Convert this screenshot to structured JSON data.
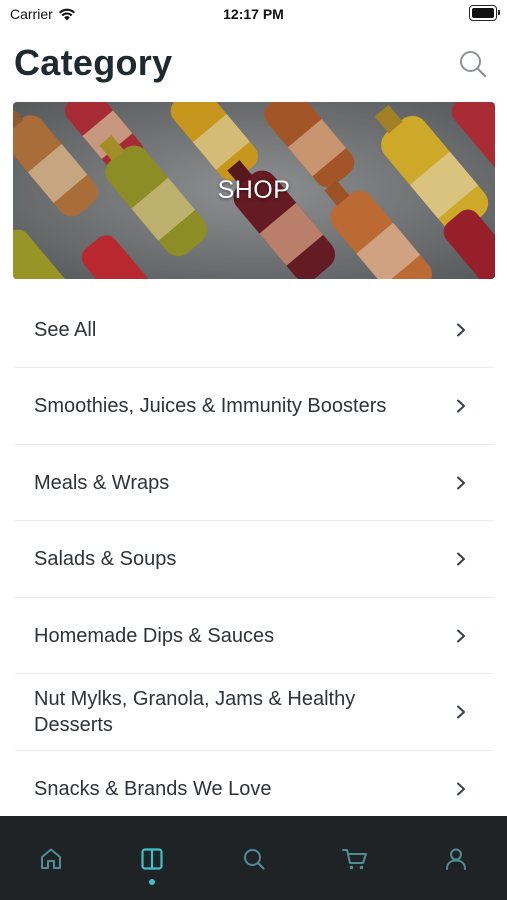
{
  "status_bar": {
    "carrier": "Carrier",
    "time": "12:17 PM"
  },
  "header": {
    "title": "Category"
  },
  "banner": {
    "label": "SHOP"
  },
  "categories": [
    {
      "label": "See All"
    },
    {
      "label": "Smoothies, Juices & Immunity Boosters"
    },
    {
      "label": "Meals & Wraps"
    },
    {
      "label": "Salads & Soups"
    },
    {
      "label": "Homemade Dips & Sauces"
    },
    {
      "label": "Nut Mylks, Granola, Jams & Healthy Desserts"
    },
    {
      "label": "Snacks & Brands We Love"
    }
  ],
  "tab_bar": {
    "tabs": [
      {
        "icon": "home-icon",
        "active": false
      },
      {
        "icon": "catalog-icon",
        "active": true
      },
      {
        "icon": "search-icon",
        "active": false
      },
      {
        "icon": "cart-icon",
        "active": false
      },
      {
        "icon": "profile-icon",
        "active": false
      }
    ]
  },
  "colors": {
    "accent": "#3bc1c8",
    "tab_inactive": "#4f8c94",
    "tab_bar_bg": "#202326",
    "title": "#1f2a30"
  }
}
